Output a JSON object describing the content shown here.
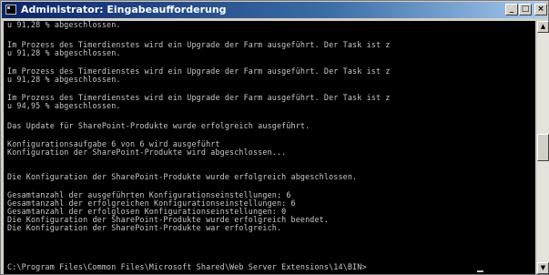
{
  "window": {
    "title": "Administrator: Eingabeaufforderung",
    "minimize_glyph": "_",
    "maximize_glyph": "□",
    "close_glyph": "×"
  },
  "console": {
    "lines": [
      "u 91,28 % abgeschlossen.",
      "",
      "Im Prozess des Timerdienstes wird ein Upgrade der Farm ausgeführt. Der Task ist z",
      "u 91,28 % abgeschlossen.",
      "",
      "Im Prozess des Timerdienstes wird ein Upgrade der Farm ausgeführt. Der Task ist z",
      "u 91,28 % abgeschlossen.",
      "",
      "Im Prozess des Timerdienstes wird ein Upgrade der Farm ausgeführt. Der Task ist z",
      "u 94,95 % abgeschlossen.",
      "",
      "Das Update für SharePoint-Produkte wurde erfolgreich ausgeführt.",
      "",
      "Konfigurationsaufgabe 6 von 6 wird ausgeführt",
      "Konfiguration der SharePoint-Produkte wird abgeschlossen...",
      "",
      "Die Konfiguration der SharePoint-Produkte wurde erfolgreich abgeschlossen.",
      "",
      "Gesamtanzahl der ausgeführten Konfigurationseinstellungen: 6",
      "Gesamtanzahl der erfolgreichen Konfigurationseinstellungen: 6",
      "Gesamtanzahl der erfolglosen Konfigurationseinstellungen: 0",
      "Die Konfiguration der SharePoint-Produkte wurde erfolgreich beendet.",
      "Die Konfiguration der SharePoint-Produkte war erfolgreich.",
      "",
      "C:\\Program Files\\Common Files\\Microsoft Shared\\Web Server Extensions\\14\\BIN>"
    ]
  },
  "scrollbar": {
    "up_glyph": "▲",
    "down_glyph": "▼",
    "position_fraction": 0.5
  }
}
